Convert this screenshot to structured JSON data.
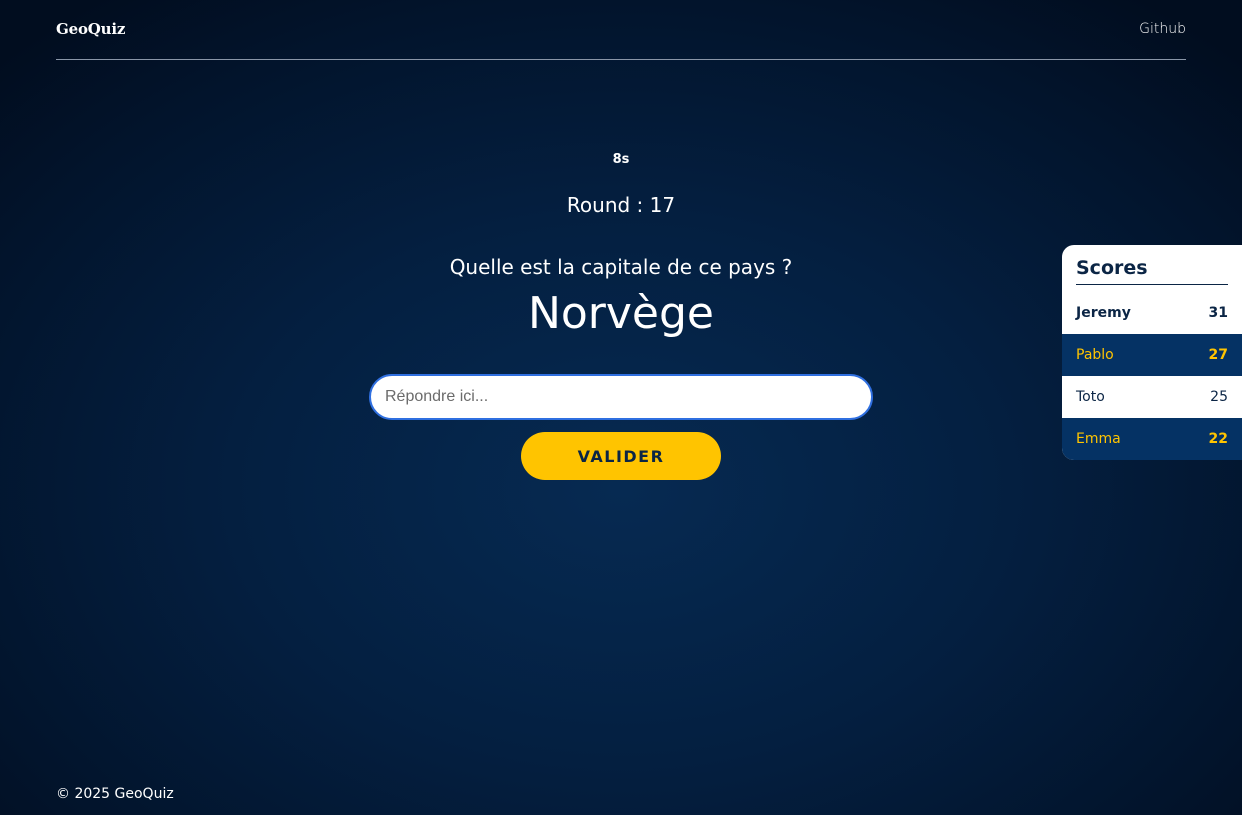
{
  "header": {
    "logo": "GeoQuiz",
    "github_link": "Github"
  },
  "game": {
    "timer": "8s",
    "round": "Round : 17",
    "question": "Quelle est la capitale de ce pays ?",
    "country": "Norvège",
    "answer_placeholder": "Répondre ici...",
    "answer_value": "",
    "submit_label": "VALIDER"
  },
  "scores": {
    "title": "Scores",
    "players": [
      {
        "name": "Jeremy",
        "points": "31"
      },
      {
        "name": "Pablo",
        "points": "27"
      },
      {
        "name": "Toto",
        "points": "25"
      },
      {
        "name": "Emma",
        "points": "22"
      }
    ]
  },
  "footer": {
    "copyright": "© 2025 GeoQuiz"
  },
  "colors": {
    "background": "#031c3a",
    "accent": "#ffc400",
    "navy": "#053264",
    "input_border": "#2f6fe0"
  }
}
